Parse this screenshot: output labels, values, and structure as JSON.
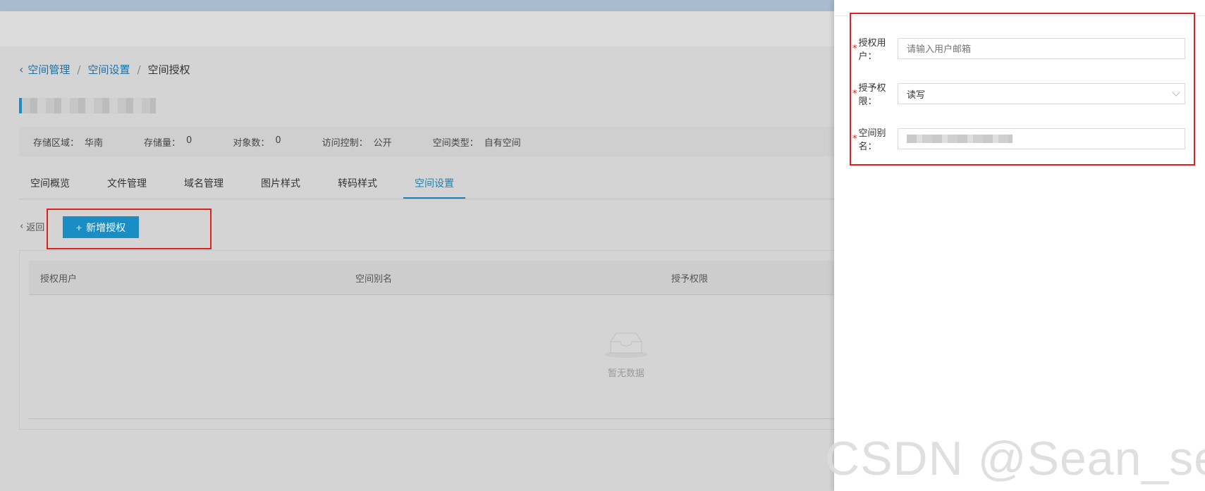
{
  "breadcrumb": {
    "items": [
      "空间管理",
      "空间设置",
      "空间授权"
    ],
    "separator": "/"
  },
  "info": [
    {
      "label": "存储区域：",
      "value": "华南"
    },
    {
      "label": "存储量：",
      "value": "0"
    },
    {
      "label": "对象数：",
      "value": "0"
    },
    {
      "label": "访问控制：",
      "value": "公开"
    },
    {
      "label": "空间类型：",
      "value": "自有空间"
    }
  ],
  "tabs": [
    "空间概览",
    "文件管理",
    "域名管理",
    "图片样式",
    "转码样式",
    "空间设置"
  ],
  "active_tab": "空间设置",
  "toolbar": {
    "back_label": "返回",
    "add_label": "新增授权"
  },
  "table": {
    "columns": [
      "授权用户",
      "空间别名",
      "授予权限"
    ],
    "empty_text": "暂无数据"
  },
  "drawer": {
    "fields": [
      {
        "label": "授权用户：",
        "placeholder": "请输入用户邮箱"
      },
      {
        "label": "授予权限：",
        "value": "读写"
      },
      {
        "label": "空间别名：",
        "value": ""
      }
    ]
  },
  "watermark": "CSDN @Sean_se",
  "colors": {
    "accent": "#1a8dc4",
    "highlight": "#e02020"
  }
}
